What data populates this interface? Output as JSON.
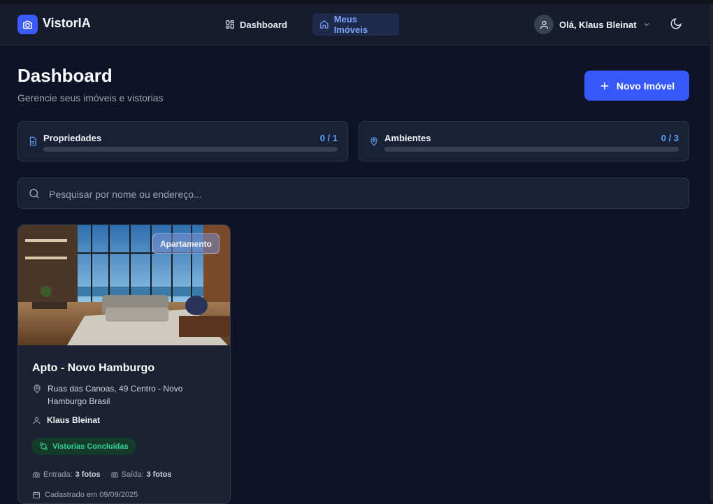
{
  "app": {
    "name": "VistorIA"
  },
  "nav": {
    "dashboard": "Dashboard",
    "meus_imoveis": "Meus Imóveis"
  },
  "user": {
    "greeting": "Olá, Klaus Bleinat"
  },
  "page": {
    "title": "Dashboard",
    "subtitle": "Gerencie seus imóveis e vistorias",
    "new_button": "Novo Imóvel"
  },
  "stats": [
    {
      "label": "Propriedades",
      "count": "0 / 1",
      "progress_percent": 0,
      "icon": "document-icon"
    },
    {
      "label": "Ambientes",
      "count": "0 / 3",
      "progress_percent": 0,
      "icon": "location-pin-icon"
    }
  ],
  "search": {
    "placeholder": "Pesquisar por nome ou endereço..."
  },
  "property": {
    "type": "Apartamento",
    "title": "Apto - Novo Hamburgo",
    "address": "Ruas das Canoas, 49 Centro - Novo Hamburgo Brasil",
    "owner": "Klaus Bleinat",
    "status": "Vistorias Concluídas",
    "entrada_label": "Entrada:",
    "entrada_value": "3 fotos",
    "saida_label": "Saída:",
    "saida_value": "3 fotos",
    "created": "Cadastrado em 09/09/2025"
  },
  "colors": {
    "background": "#0f1327",
    "accent": "#3758f9",
    "status_green": "#34d399",
    "count_blue": "#60a5fa"
  }
}
